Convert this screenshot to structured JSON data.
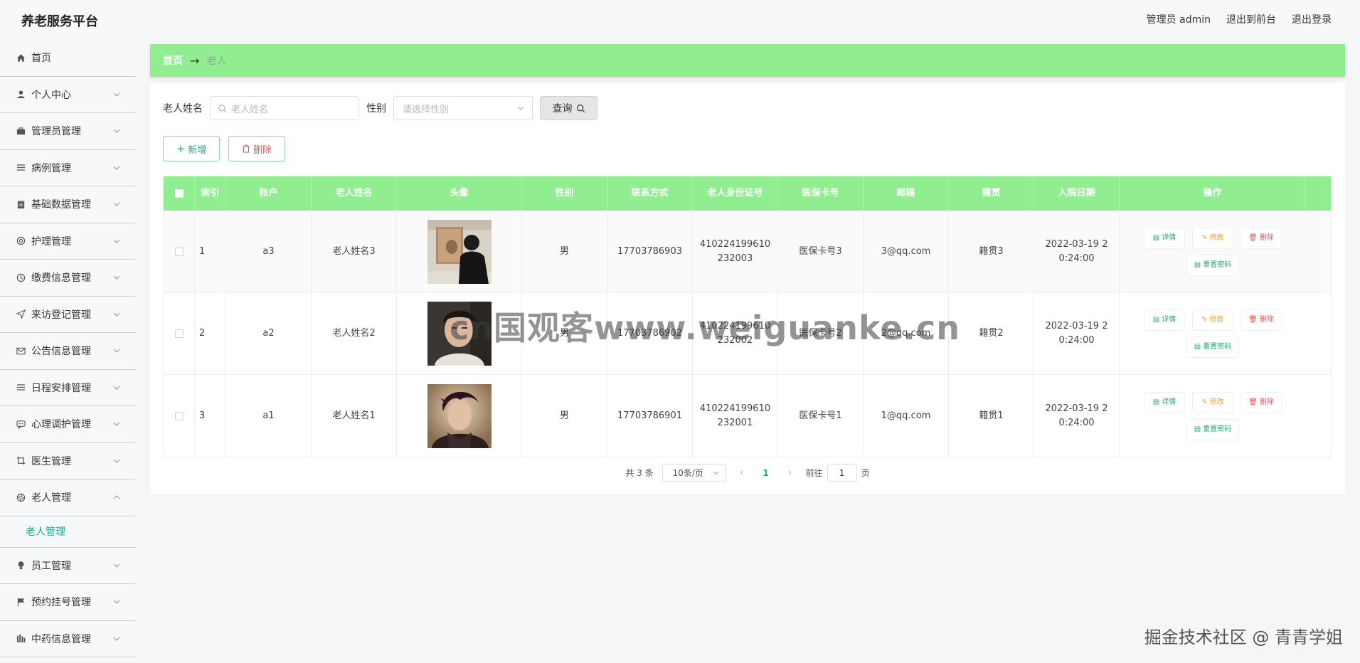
{
  "header": {
    "brand": "养老服务平台",
    "user": "管理员 admin",
    "front": "退出到前台",
    "logout": "退出登录"
  },
  "sidebar": {
    "items": [
      {
        "label": "首页",
        "icon": "home-icon"
      },
      {
        "label": "个人中心",
        "icon": "user-icon"
      },
      {
        "label": "管理员管理",
        "icon": "briefcase-icon"
      },
      {
        "label": "病例管理",
        "icon": "list-icon"
      },
      {
        "label": "基础数据管理",
        "icon": "clipboard-icon"
      },
      {
        "label": "护理管理",
        "icon": "lifebuoy-icon"
      },
      {
        "label": "缴费信息管理",
        "icon": "clock-icon"
      },
      {
        "label": "来访登记管理",
        "icon": "send-icon"
      },
      {
        "label": "公告信息管理",
        "icon": "mail-icon"
      },
      {
        "label": "日程安排管理",
        "icon": "menu-icon"
      },
      {
        "label": "心理调护管理",
        "icon": "chat-icon"
      },
      {
        "label": "医生管理",
        "icon": "crop-icon"
      },
      {
        "label": "老人管理",
        "icon": "aperture-icon"
      }
    ],
    "sub_item": "老人管理",
    "after_items": [
      {
        "label": "员工管理",
        "icon": "bulb-icon"
      },
      {
        "label": "预约挂号管理",
        "icon": "flag-icon"
      },
      {
        "label": "中药信息管理",
        "icon": "bars-icon"
      }
    ]
  },
  "breadcrumb": {
    "home": "首页",
    "arrow": "→",
    "current": "老人"
  },
  "filter": {
    "name_label": "老人姓名",
    "name_placeholder": "老人姓名",
    "sex_label": "性别",
    "sex_placeholder": "请选择性别",
    "query": "查询"
  },
  "actions": {
    "add": "新增",
    "delete": "删除"
  },
  "table": {
    "headers": [
      "索引",
      "账户",
      "老人姓名",
      "头像",
      "性别",
      "联系方式",
      "老人身份证号",
      "医保卡号",
      "邮箱",
      "籍贯",
      "入院日期",
      "操作"
    ],
    "rows": [
      {
        "index": "1",
        "account": "a3",
        "name": "老人姓名3",
        "sex": "男",
        "phone": "17703786903",
        "idcard": "410224199610232003",
        "card": "医保卡号3",
        "email": "3@qq.com",
        "origin": "籍贯3",
        "date": "2022-03-19 20:24:00",
        "avatar": "avatar-3"
      },
      {
        "index": "2",
        "account": "a2",
        "name": "老人姓名2",
        "sex": "男",
        "phone": "17703786902",
        "idcard": "410224199610232002",
        "card": "医保卡号2",
        "email": "2@qq.com",
        "origin": "籍贯2",
        "date": "2022-03-19 20:24:00",
        "avatar": "avatar-2"
      },
      {
        "index": "3",
        "account": "a1",
        "name": "老人姓名1",
        "sex": "男",
        "phone": "17703786901",
        "idcard": "410224199610232001",
        "card": "医保卡号1",
        "email": "1@qq.com",
        "origin": "籍贯1",
        "date": "2022-03-19 20:24:00",
        "avatar": "avatar-1"
      }
    ],
    "ops": {
      "detail": "详情",
      "edit": "修改",
      "remove": "删除",
      "reset": "重置密码"
    }
  },
  "pager": {
    "total": "共 3 条",
    "size": "10条/页",
    "current": "1",
    "goto": "前往",
    "page_value": "1",
    "page_unit": "页"
  },
  "watermarks": {
    "center": "cn国观客www.weiguanke.cn",
    "corner": "掘金技术社区 @ 青青学姐"
  },
  "colors": {
    "accent": "#90ee90",
    "active": "#1aae8c",
    "danger": "#e05555",
    "warn": "#e6a23c"
  }
}
